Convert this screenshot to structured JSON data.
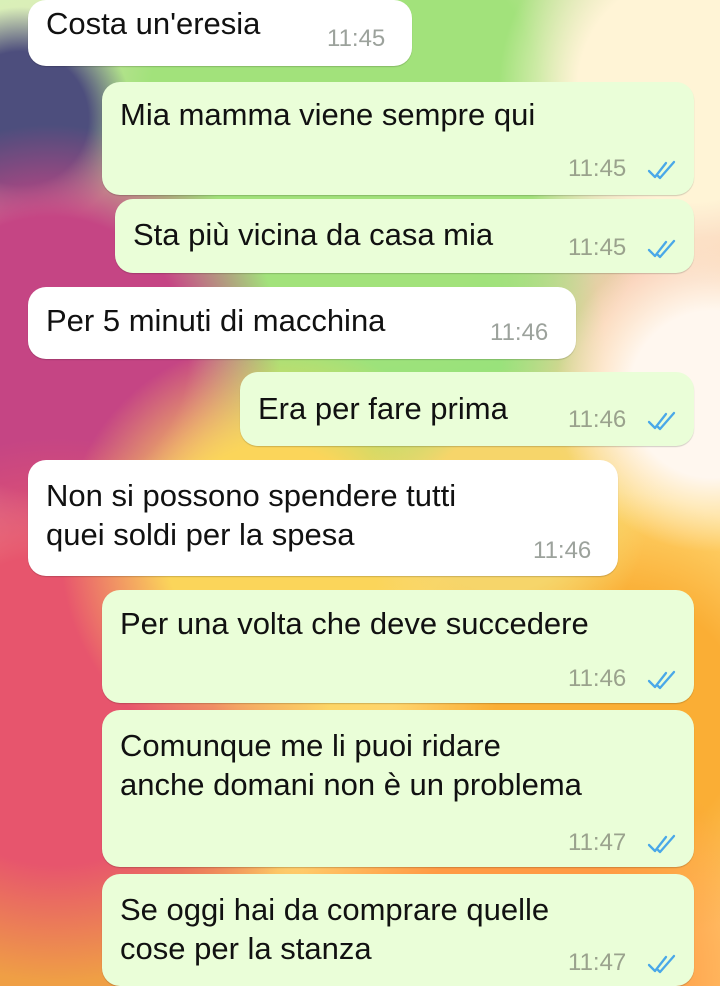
{
  "messages": [
    {
      "direction": "incoming",
      "text_lines": [
        "Costa un'eresia"
      ],
      "time": "11:45",
      "ticks": false
    },
    {
      "direction": "outgoing",
      "text_lines": [
        "Mia mamma viene sempre qui"
      ],
      "time": "11:45",
      "ticks": true
    },
    {
      "direction": "outgoing",
      "text_lines": [
        "Sta più vicina da casa mia"
      ],
      "time": "11:45",
      "ticks": true
    },
    {
      "direction": "incoming",
      "text_lines": [
        "Per 5 minuti di macchina"
      ],
      "time": "11:46",
      "ticks": false
    },
    {
      "direction": "outgoing",
      "text_lines": [
        "Era per fare prima"
      ],
      "time": "11:46",
      "ticks": true
    },
    {
      "direction": "incoming",
      "text_lines": [
        "Non si possono spendere tutti",
        "quei soldi per la spesa"
      ],
      "time": "11:46",
      "ticks": false
    },
    {
      "direction": "outgoing",
      "text_lines": [
        "Per una volta che deve succedere"
      ],
      "time": "11:46",
      "ticks": true
    },
    {
      "direction": "outgoing",
      "text_lines": [
        "Comunque me li puoi ridare",
        "anche domani non è un problema"
      ],
      "time": "11:47",
      "ticks": true
    },
    {
      "direction": "outgoing",
      "text_lines": [
        "Se oggi hai da comprare quelle",
        "cose per la stanza"
      ],
      "time": "11:47",
      "ticks": true
    }
  ],
  "colors": {
    "incoming_bubble": "#ffffff",
    "outgoing_bubble": "#eafed8",
    "timestamp": "#9aa28d",
    "read_ticks": "#4aa8e8"
  },
  "icons": {
    "read_receipt": "double-check-icon"
  }
}
